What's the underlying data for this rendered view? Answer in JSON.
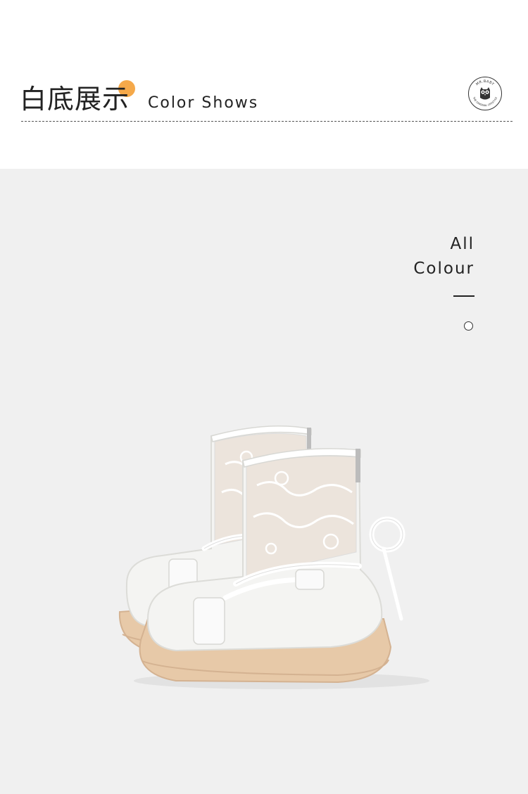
{
  "header": {
    "title_cn": "白底展示",
    "title_en": "Color Shows",
    "accent_color": "#f5a94a",
    "badge": {
      "top_text": "MR.BABY",
      "bottom_text": "THE ORIGINAL LIFESTYLE",
      "icon": "owl-logo-icon"
    }
  },
  "color_panel": {
    "line1": "All",
    "line2": "Colour",
    "swatches": [
      {
        "color": "#ffffff"
      }
    ]
  },
  "product": {
    "image": "white-lace-ankle-boots-image",
    "colors": {
      "upper": "#f4f4f2",
      "lace": "#ece4dc",
      "sole": "#e7c9a8"
    }
  }
}
